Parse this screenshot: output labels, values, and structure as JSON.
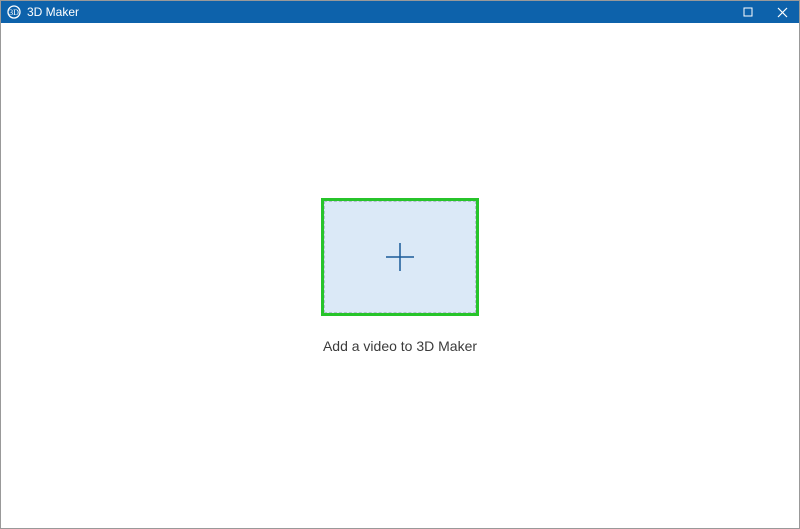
{
  "window": {
    "title": "3D Maker"
  },
  "main": {
    "caption": "Add a video to 3D Maker"
  }
}
